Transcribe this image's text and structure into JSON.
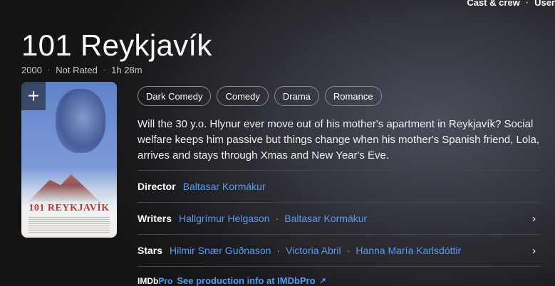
{
  "nav": {
    "cast_crew": "Cast & crew",
    "user": "User"
  },
  "title": "101 Reykjavík",
  "meta": {
    "year": "2000",
    "rating": "Not Rated",
    "runtime": "1h 28m"
  },
  "poster": {
    "title_text": "101 REYKJAVÍK",
    "add_icon": "plus-icon"
  },
  "genres": [
    "Dark Comedy",
    "Comedy",
    "Drama",
    "Romance"
  ],
  "plot": "Will the 30 y.o. Hlynur ever move out of his mother's apartment in Reykjavík? Social welfare keeps him passive but things change when his mother's Spanish friend, Lola, arrives and stays through Xmas and New Year's Eve.",
  "credits": {
    "director_label": "Director",
    "directors": [
      "Baltasar Kormákur"
    ],
    "writers_label": "Writers",
    "writers": [
      "Hallgrímur Helgason",
      "Baltasar Kormákur"
    ],
    "stars_label": "Stars",
    "stars": [
      "Hilmir Snær Guðnason",
      "Victoria Abril",
      "Hanna María Karlsdóttir"
    ]
  },
  "imdbpro": {
    "logo_main": "IMDb",
    "logo_pro": "Pro",
    "link_text": "See production info at IMDbPro"
  },
  "colors": {
    "link": "#5799ef",
    "chip_border": "#8a8a8a"
  }
}
